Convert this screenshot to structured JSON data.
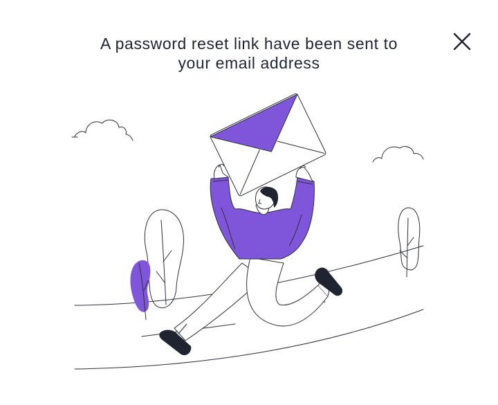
{
  "dialog": {
    "message_line1": "A password reset link have been sent to",
    "message_line2": "your email address"
  },
  "icons": {
    "close": "close-icon",
    "illustration": "man-holding-envelope-illustration"
  },
  "colors": {
    "accent": "#7f56d9",
    "text": "#1f2430",
    "line": "#2b2f38",
    "shoe": "#1f2430"
  }
}
